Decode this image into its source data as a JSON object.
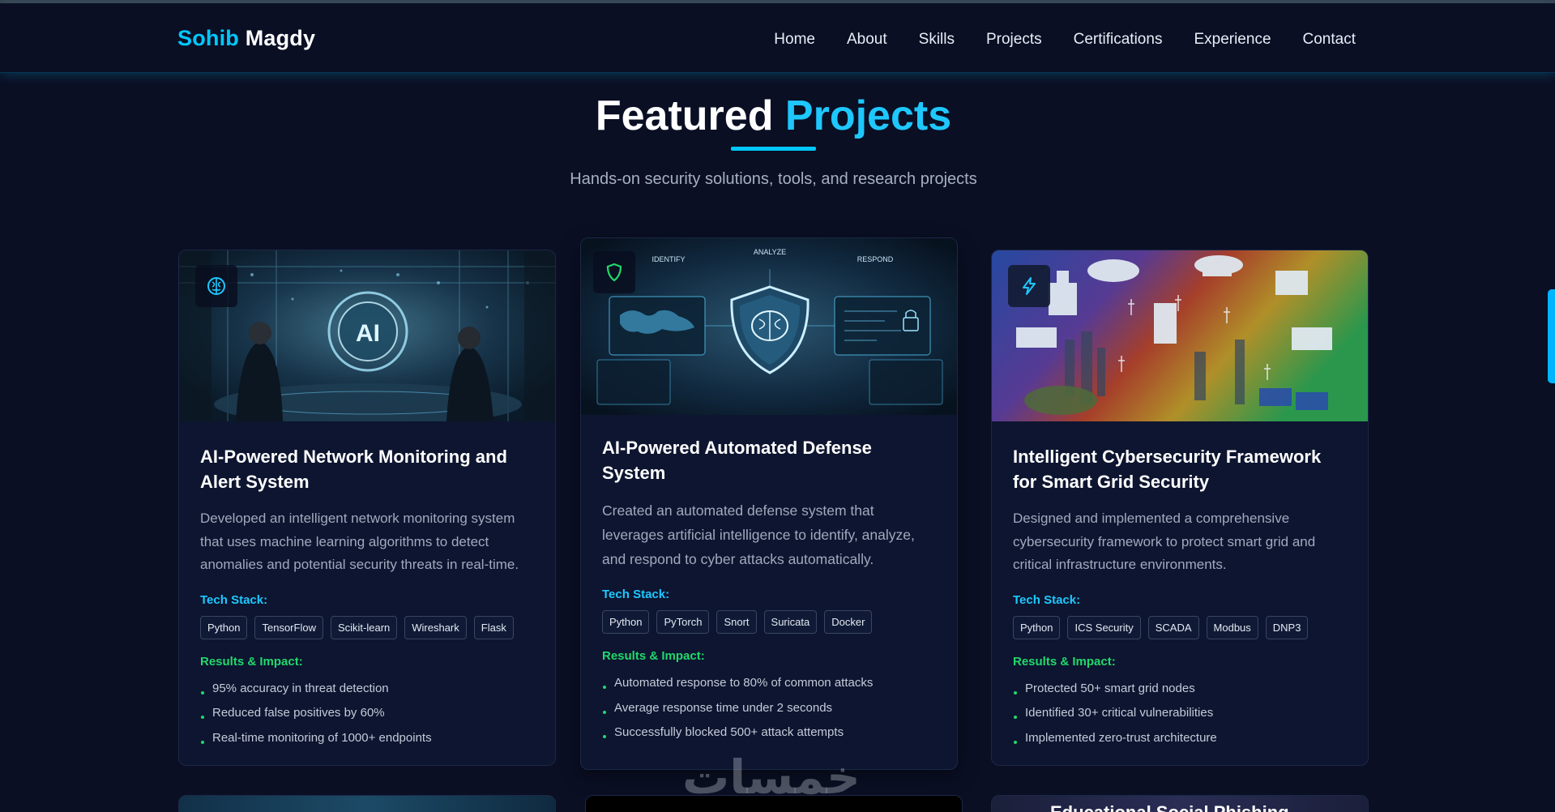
{
  "brand": {
    "first": "Sohib",
    "last": "Magdy"
  },
  "nav": [
    "Home",
    "About",
    "Skills",
    "Projects",
    "Certifications",
    "Experience",
    "Contact"
  ],
  "section": {
    "title_main": "Featured",
    "title_accent": "Projects",
    "subtitle": "Hands-on security solutions, tools, and research projects"
  },
  "labels": {
    "tech": "Tech Stack:",
    "results": "Results & Impact:"
  },
  "colors": {
    "background": "#0a0f24",
    "accent": "#00c8ff",
    "success": "#22d86b",
    "card": "#0d1530"
  },
  "projects": [
    {
      "icon": "brain-icon",
      "image_text": "AI",
      "title": "AI-Powered Network Monitoring and Alert System",
      "description": "Developed an intelligent network monitoring system that uses machine learning algorithms to detect anomalies and potential security threats in real-time.",
      "tech": [
        "Python",
        "TensorFlow",
        "Scikit-learn",
        "Wireshark",
        "Flask"
      ],
      "results": [
        "95% accuracy in threat detection",
        "Reduced false positives by 60%",
        "Real-time monitoring of 1000+ endpoints"
      ]
    },
    {
      "icon": "shield-icon",
      "image_labels": [
        "IDENTIFY",
        "ANALYZE",
        "RESPOND"
      ],
      "title": "AI-Powered Automated Defense System",
      "description": "Created an automated defense system that leverages artificial intelligence to identify, analyze, and respond to cyber attacks automatically.",
      "tech": [
        "Python",
        "PyTorch",
        "Snort",
        "Suricata",
        "Docker"
      ],
      "results": [
        "Automated response to 80% of common attacks",
        "Average response time under 2 seconds",
        "Successfully blocked 500+ attack attempts"
      ]
    },
    {
      "icon": "lightning-icon",
      "title": "Intelligent Cybersecurity Framework for Smart Grid Security",
      "description": "Designed and implemented a comprehensive cybersecurity framework to protect smart grid and critical infrastructure environments.",
      "tech": [
        "Python",
        "ICS Security",
        "SCADA",
        "Modbus",
        "DNP3"
      ],
      "results": [
        "Protected 50+ smart grid nodes",
        "Identified 30+ critical vulnerabilities",
        "Implemented zero-trust architecture"
      ]
    }
  ],
  "partial_card_title": "Educational Social Phishing",
  "watermark": "خمسات"
}
